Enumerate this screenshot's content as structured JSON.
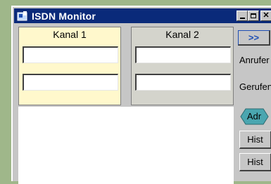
{
  "window": {
    "title": "ISDN Monitor"
  },
  "titlebar_buttons": {
    "minimize": "_",
    "maximize": "□",
    "close": "✕"
  },
  "channels": [
    {
      "label": "Kanal 1",
      "caller_value": "",
      "called_value": ""
    },
    {
      "label": "Kanal 2",
      "caller_value": "",
      "called_value": ""
    }
  ],
  "side": {
    "expand_label": ">>",
    "anrufer_label": "Anrufer",
    "gerufen_label": "Gerufen",
    "adr_label": "Adr",
    "hist1_label": "Hist",
    "hist2_label": "Hist"
  },
  "colors": {
    "titlebar": "#0a2a7a",
    "window_bg": "#c6c6c6",
    "kanal1_active_bg": "#fff8cc",
    "kanal2_bg": "#d4d4cc",
    "adr_accent": "#4aa6b0"
  }
}
